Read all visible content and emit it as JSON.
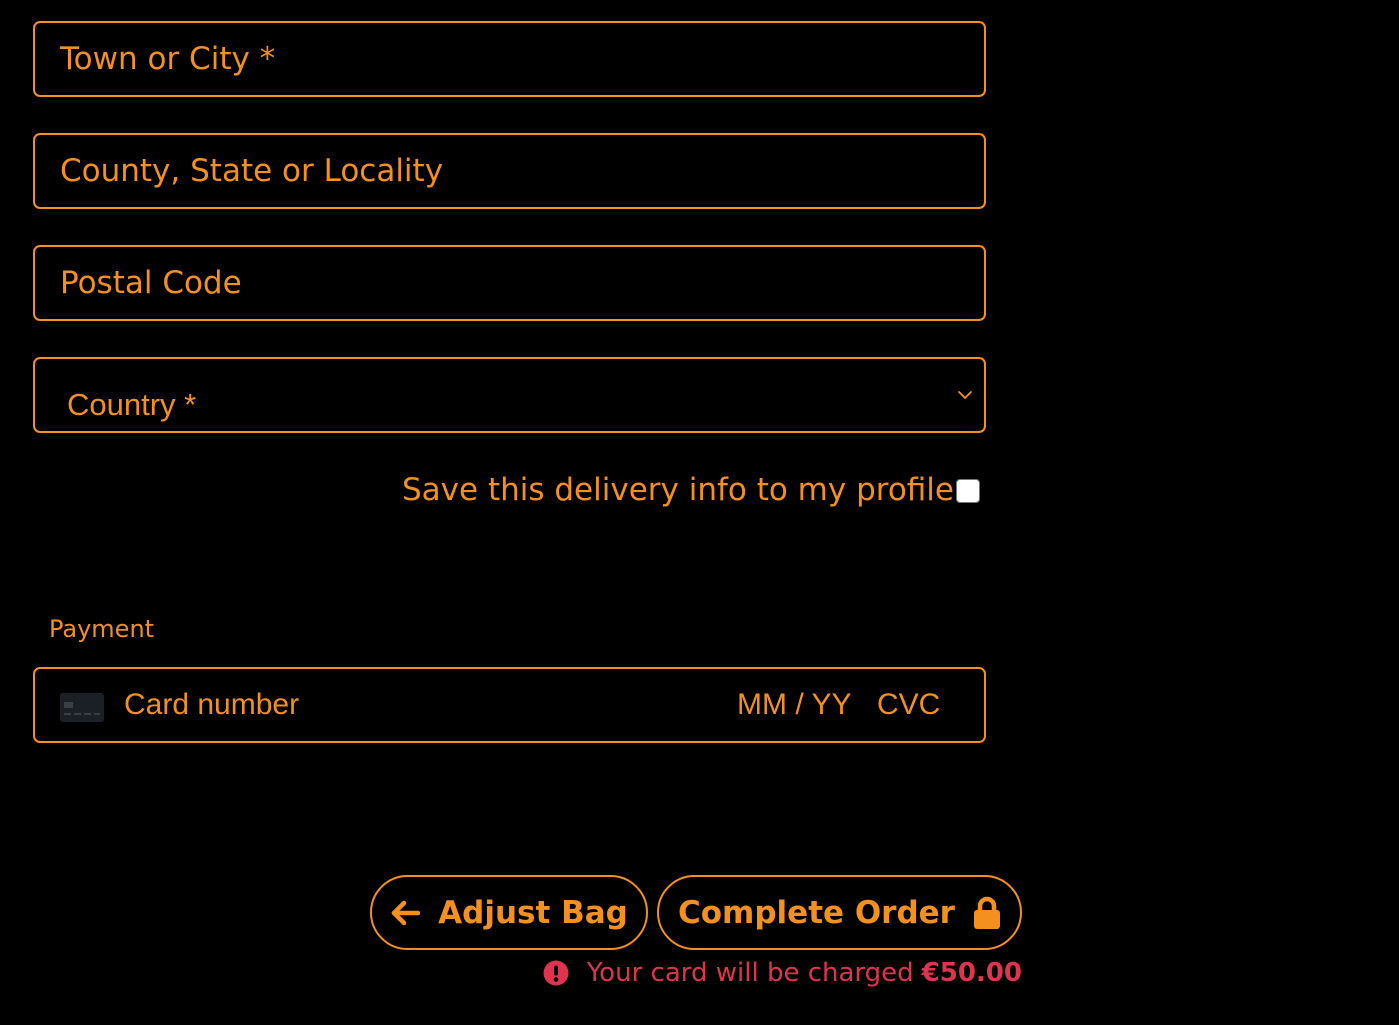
{
  "delivery": {
    "town_placeholder": "Town or City *",
    "county_placeholder": "County, State or Locality",
    "postal_placeholder": "Postal Code",
    "country_placeholder": "Country *",
    "save_info_label": "Save this delivery info to my profile",
    "save_info_checked": false
  },
  "payment": {
    "section_label": "Payment",
    "card_number_placeholder": "Card number",
    "expiry_placeholder": "MM / YY",
    "cvc_placeholder": "CVC"
  },
  "actions": {
    "adjust_bag_label": "Adjust Bag",
    "complete_order_label": "Complete Order"
  },
  "charge_notice": {
    "text": "Your card will be charged",
    "amount": "€50.00"
  },
  "colors": {
    "accent": "#F4901E",
    "background": "#000000",
    "alert": "#E0334E"
  },
  "icons": {
    "country_dropdown": "chevron-down-icon",
    "card": "credit-card-icon",
    "adjust_bag": "arrow-left-icon",
    "complete_order": "lock-icon",
    "charge_notice": "exclamation-circle-icon"
  }
}
